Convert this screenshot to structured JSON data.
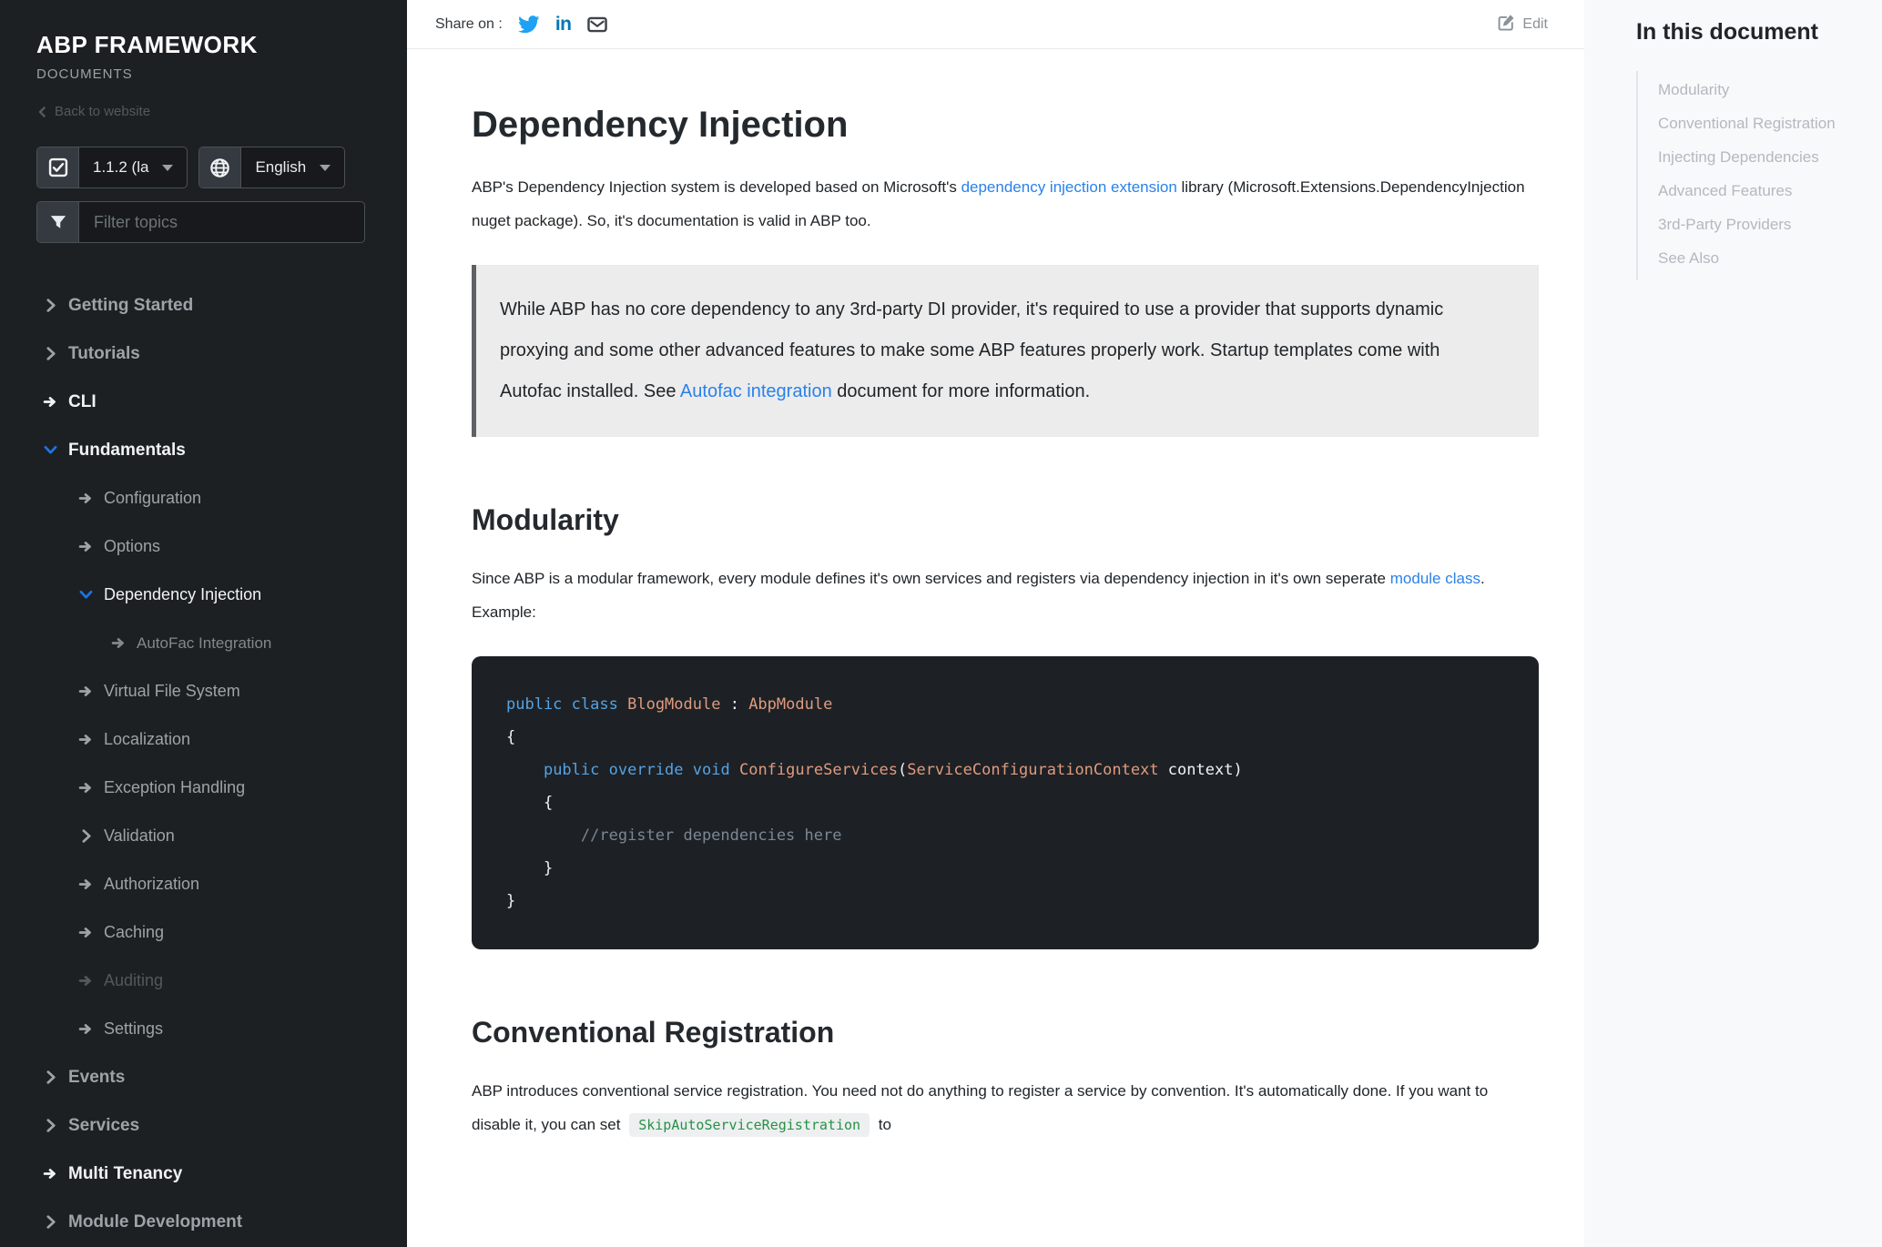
{
  "sidebar": {
    "title": "ABP FRAMEWORK",
    "subtitle": "DOCUMENTS",
    "back_label": "Back to website",
    "version_select": {
      "value": "1.1.2 (la"
    },
    "language_select": {
      "value": "English"
    },
    "filter_placeholder": "Filter topics",
    "nav": [
      {
        "label": "Getting Started",
        "level": 1,
        "icon": "chevron-right",
        "tone": "gray"
      },
      {
        "label": "Tutorials",
        "level": 1,
        "icon": "chevron-right",
        "tone": "gray"
      },
      {
        "label": "CLI",
        "level": 1,
        "icon": "arrow",
        "tone": "white"
      },
      {
        "label": "Fundamentals",
        "level": 1,
        "icon": "chevron-down",
        "tone": "white"
      },
      {
        "label": "Configuration",
        "level": 2,
        "icon": "arrow",
        "tone": "gray"
      },
      {
        "label": "Options",
        "level": 2,
        "icon": "arrow",
        "tone": "gray"
      },
      {
        "label": "Dependency Injection",
        "level": 2,
        "icon": "chevron-down",
        "tone": "white"
      },
      {
        "label": "AutoFac Integration",
        "level": 3,
        "icon": "arrow",
        "tone": "muted"
      },
      {
        "label": "Virtual File System",
        "level": 2,
        "icon": "arrow",
        "tone": "gray"
      },
      {
        "label": "Localization",
        "level": 2,
        "icon": "arrow",
        "tone": "gray"
      },
      {
        "label": "Exception Handling",
        "level": 2,
        "icon": "arrow",
        "tone": "gray"
      },
      {
        "label": "Validation",
        "level": 2,
        "icon": "chevron-right",
        "tone": "gray"
      },
      {
        "label": "Authorization",
        "level": 2,
        "icon": "arrow",
        "tone": "gray"
      },
      {
        "label": "Caching",
        "level": 2,
        "icon": "arrow",
        "tone": "gray"
      },
      {
        "label": "Auditing",
        "level": 2,
        "icon": "arrow",
        "tone": "dim"
      },
      {
        "label": "Settings",
        "level": 2,
        "icon": "arrow",
        "tone": "gray"
      },
      {
        "label": "Events",
        "level": 1,
        "icon": "chevron-right",
        "tone": "gray"
      },
      {
        "label": "Services",
        "level": 1,
        "icon": "chevron-right",
        "tone": "gray"
      },
      {
        "label": "Multi Tenancy",
        "level": 1,
        "icon": "arrow",
        "tone": "white"
      },
      {
        "label": "Module Development",
        "level": 1,
        "icon": "chevron-right",
        "tone": "gray"
      }
    ]
  },
  "topbar": {
    "share_label": "Share on :",
    "share_icons": [
      "twitter",
      "linkedin",
      "email"
    ],
    "edit_label": "Edit"
  },
  "article": {
    "title": "Dependency Injection",
    "intro": [
      {
        "t": "ABP's Dependency Injection system is developed based on Microsoft's "
      },
      {
        "t": "dependency injection extension",
        "s": "link"
      },
      {
        "t": " library (Microsoft.Extensions.DependencyInjection nuget package). So, it's documentation is valid in ABP too."
      }
    ],
    "callout": [
      {
        "t": "While ABP has no core dependency to any 3rd-party DI provider, it's required to use a provider that supports dynamic proxying and some other advanced features to make some ABP features properly work. Startup templates come with Autofac installed. See "
      },
      {
        "t": "Autofac integration",
        "s": "link"
      },
      {
        "t": " document for more information."
      }
    ],
    "modularity_heading": "Modularity",
    "modularity_paragraph": [
      {
        "t": "Since ABP is a modular framework, every module defines it's own services and registers via dependency injection in it's own seperate "
      },
      {
        "t": "module class",
        "s": "link"
      },
      {
        "t": ". Example:"
      }
    ],
    "code": {
      "lines": [
        [
          {
            "t": "public",
            "c": "kw"
          },
          {
            "t": " ",
            "c": "pl"
          },
          {
            "t": "class",
            "c": "kw"
          },
          {
            "t": " ",
            "c": "pl"
          },
          {
            "t": "BlogModule",
            "c": "ty"
          },
          {
            "t": " : ",
            "c": "pl"
          },
          {
            "t": "AbpModule",
            "c": "ty"
          }
        ],
        [
          {
            "t": "{",
            "c": "pl"
          }
        ],
        [
          {
            "t": "    ",
            "c": "pl"
          },
          {
            "t": "public",
            "c": "kw"
          },
          {
            "t": " ",
            "c": "pl"
          },
          {
            "t": "override",
            "c": "kw"
          },
          {
            "t": " ",
            "c": "pl"
          },
          {
            "t": "void",
            "c": "kw"
          },
          {
            "t": " ",
            "c": "pl"
          },
          {
            "t": "ConfigureServices",
            "c": "ty"
          },
          {
            "t": "(",
            "c": "pl"
          },
          {
            "t": "ServiceConfigurationContext",
            "c": "ty"
          },
          {
            "t": " context)",
            "c": "pl"
          }
        ],
        [
          {
            "t": "    {",
            "c": "pl"
          }
        ],
        [
          {
            "t": "        ",
            "c": "pl"
          },
          {
            "t": "//register dependencies here",
            "c": "cm"
          }
        ],
        [
          {
            "t": "    }",
            "c": "pl"
          }
        ],
        [
          {
            "t": "}",
            "c": "pl"
          }
        ]
      ]
    },
    "conventional_heading": "Conventional Registration",
    "conventional_paragraph": [
      {
        "t": "ABP introduces conventional service registration. You need not do anything to register a service by convention. It's automatically done. If you want to disable it, you can set "
      },
      {
        "t": "SkipAutoServiceRegistration",
        "s": "chip"
      },
      {
        "t": " to"
      }
    ]
  },
  "toc": {
    "title": "In this document",
    "items": [
      "Modularity",
      "Conventional Registration",
      "Injecting Dependencies",
      "Advanced Features",
      "3rd-Party Providers",
      "See Also"
    ]
  },
  "colors": {
    "link_blue": "#2a81ea",
    "nav_active_chevron_blue": "#1b74e4",
    "twitter_blue": "#1da1f2",
    "linkedin_blue": "#0077b5",
    "code_keyword": "#55a2e4",
    "code_type": "#e09a7e",
    "code_comment": "#7b8794",
    "inline_code_green": "#269146",
    "sidebar_background": "#1c2023",
    "toc_background": "#f8f9fa"
  }
}
